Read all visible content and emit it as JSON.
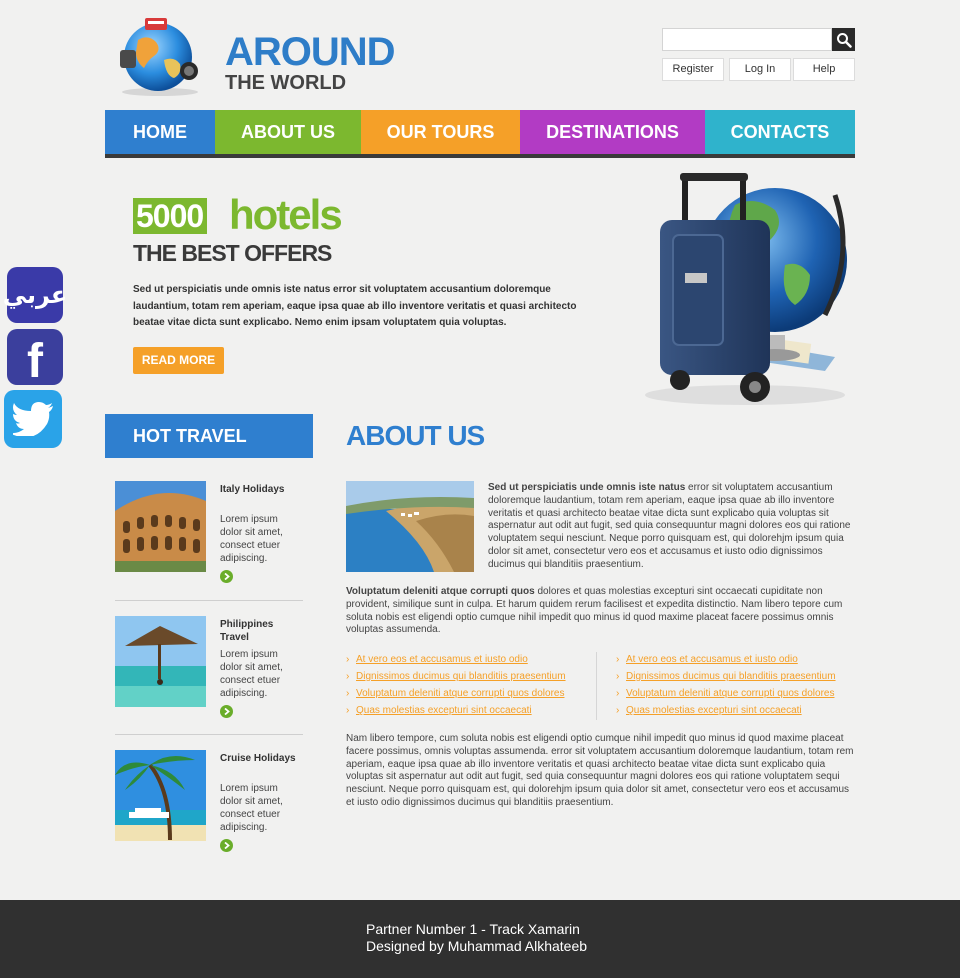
{
  "logo": {
    "title": "AROUND",
    "subtitle": "THE WORLD"
  },
  "search": {
    "placeholder": "",
    "value": ""
  },
  "toplinks": {
    "register": "Register",
    "login": "Log In",
    "help": "Help"
  },
  "nav": [
    {
      "label": "HOME",
      "color": "#2f7fcf"
    },
    {
      "label": "ABOUT US",
      "color": "#7cb82f"
    },
    {
      "label": "OUR TOURS",
      "color": "#f5a028"
    },
    {
      "label": "DESTINATIONS",
      "color": "#b23bc4"
    },
    {
      "label": "CONTACTS",
      "color": "#2fb3cc"
    }
  ],
  "hero": {
    "number": "5000",
    "word": "hotels",
    "offer": "THE BEST OFFERS",
    "text": "Sed ut perspiciatis unde omnis iste natus error sit voluptatem accusantium doloremque laudantium, totam rem aperiam, eaque ipsa quae ab illo inventore veritatis et quasi architecto beatae vitae dicta sunt explicabo. Nemo enim ipsam voluptatem quia voluptas.",
    "button": "READ MORE"
  },
  "hot": {
    "heading": "HOT TRAVEL",
    "items": [
      {
        "title": "Italy Holidays",
        "desc": "Lorem ipsum dolor sit amet, consect etuer adipiscing."
      },
      {
        "title": "Philippines Travel",
        "desc": "Lorem ipsum dolor sit amet, consect etuer adipiscing."
      },
      {
        "title": "Cruise Holidays",
        "desc": "Lorem ipsum dolor sit amet, consect etuer adipiscing."
      }
    ]
  },
  "about": {
    "title": "ABOUT US",
    "p1_bold": "Sed ut perspiciatis unde omnis iste natus",
    "p1": " error sit voluptatem accusantium doloremque laudantium, totam rem aperiam, eaque ipsa quae ab illo inventore veritatis et quasi architecto beatae vitae dicta sunt explicabo quia voluptas sit aspernatur aut odit aut fugit, sed quia consequuntur magni dolores eos qui ratione voluptatem sequi nesciunt. Neque porro quisquam est, qui dolorehjm ipsum quia dolor sit amet, consectetur vero eos et accusamus et iusto odio dignissimos ducimus qui blanditiis praesentium.",
    "p2_bold": "Voluptatum deleniti atque corrupti quos",
    "p2": " dolores et quas molestias excepturi sint occaecati cupiditate non provident, similique sunt in culpa. Et harum quidem rerum facilisest et expedita distinctio. Nam libero tepore cum soluta nobis est eligendi optio cumque nihil impedit quo minus id quod maxime placeat facere possimus omnis voluptas assumenda.",
    "links_left": [
      "At vero eos et accusamus et iusto odio",
      "Dignissimos ducimus qui blanditiis praesentium",
      "Voluptatum deleniti atque corrupti quos dolores",
      "Quas molestias excepturi sint occaecati"
    ],
    "links_right": [
      "At vero eos et accusamus et iusto odio",
      "Dignissimos ducimus qui blanditiis praesentium",
      "Voluptatum deleniti atque corrupti quos dolores",
      "Quas molestias excepturi sint occaecati"
    ],
    "p3": "Nam libero tempore, cum soluta nobis est eligendi optio cumque nihil impedit quo minus id quod maxime placeat facere possimus, omnis voluptas assumenda. error sit voluptatem accusantium doloremque laudantium, totam rem aperiam, eaque ipsa quae ab illo inventore veritatis et quasi architecto beatae vitae dicta sunt explicabo quia voluptas sit aspernatur aut odit aut fugit, sed quia consequuntur magni dolores eos qui ratione voluptatem sequi nesciunt. Neque porro quisquam est, qui dolorehjm ipsum quia dolor sit amet, consectetur vero eos et accusamus et iusto odio dignissimos ducimus qui blanditiis praesentium."
  },
  "social": {
    "arabic": "عربي",
    "facebook": "f"
  },
  "footer": {
    "line1": "Partner Number 1 - Track Xamarin",
    "line2": "Designed by Muhammad Alkhateeb"
  }
}
